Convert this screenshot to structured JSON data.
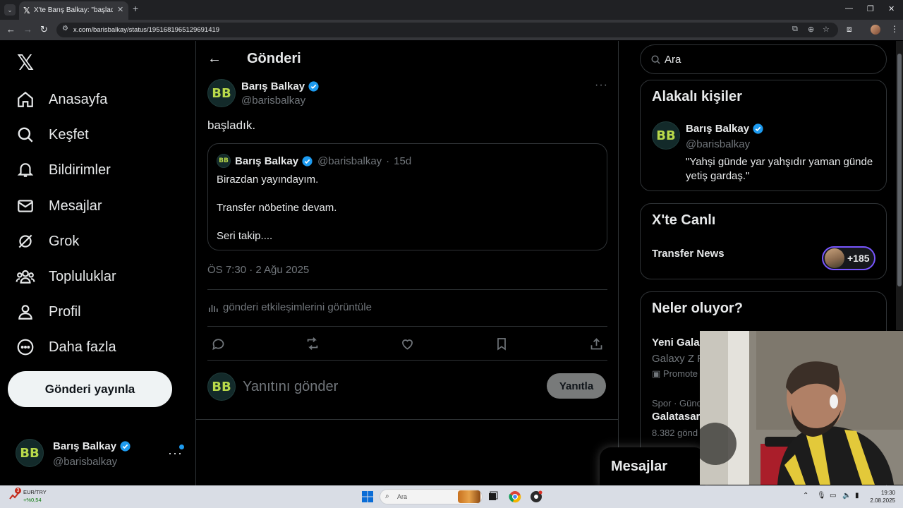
{
  "browser": {
    "tab_title": "X'te Barış Balkay: \"başladık.\" / X",
    "url": "x.com/barisbalkay/status/1951681965129691419"
  },
  "nav": {
    "items": [
      {
        "label": "Anasayfa",
        "icon": "home-icon"
      },
      {
        "label": "Keşfet",
        "icon": "search-icon"
      },
      {
        "label": "Bildirimler",
        "icon": "bell-icon"
      },
      {
        "label": "Mesajlar",
        "icon": "mail-icon"
      },
      {
        "label": "Grok",
        "icon": "grok-icon"
      },
      {
        "label": "Topluluklar",
        "icon": "communities-icon"
      },
      {
        "label": "Profil",
        "icon": "person-icon"
      },
      {
        "label": "Daha fazla",
        "icon": "more-circle-icon"
      }
    ],
    "post_button": "Gönderi yayınla"
  },
  "account": {
    "avatar_text": "BB",
    "name": "Barış Balkay",
    "handle": "@barisbalkay"
  },
  "main": {
    "title": "Gönderi",
    "post": {
      "author_name": "Barış Balkay",
      "author_handle": "@barisbalkay",
      "text": "başladık.",
      "timestamp": "ÖS 7:30 · 2 Ağu 2025",
      "engagement_link": "gönderi etkileşimlerini görüntüle"
    },
    "quote": {
      "author_name": "Barış Balkay",
      "author_handle": "@barisbalkay",
      "separator": "·",
      "time": "15d",
      "lines": [
        "Birazdan yayındayım.",
        "Transfer nöbetine devam.",
        "Seri takip...."
      ]
    },
    "reply": {
      "placeholder": "Yanıtını gönder",
      "button": "Yanıtla"
    }
  },
  "sidebar": {
    "search_text": "Ara",
    "related": {
      "title": "Alakalı kişiler",
      "name": "Barış Balkay",
      "handle": "@barisbalkay",
      "bio": "\"Yahşi günde yar yahşıdır yaman günde yetiş gardaş.\""
    },
    "live": {
      "title": "X'te Canlı",
      "name": "Transfer News",
      "count": "+185"
    },
    "trends": {
      "title": "Neler oluyor?",
      "items": [
        {
          "title": "Yeni Gala",
          "subtitle": "Galaxy Z F",
          "meta": "Promote"
        },
        {
          "category": "Spor · Günd",
          "title": "Galatasar",
          "meta": "8.382 gönd"
        }
      ]
    },
    "messages_drawer": "Mesajlar"
  },
  "taskbar": {
    "badge": "3",
    "currency": "EUR/TRY",
    "change": "+%0,54",
    "search": "Ara",
    "time": "19:30",
    "date": "2.08.2025"
  },
  "colors": {
    "accent": "#1d9bf0",
    "background": "#000000",
    "border": "#2f3336",
    "muted": "#71767b",
    "live_ring": "#7856ff"
  }
}
